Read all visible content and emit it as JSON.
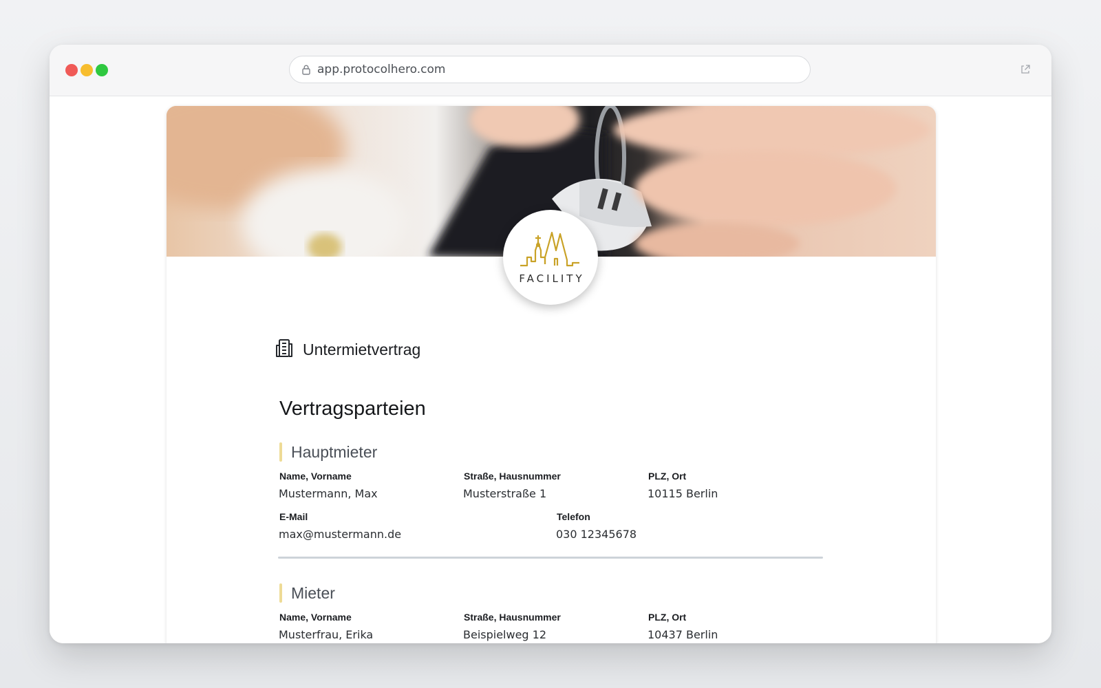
{
  "browser": {
    "url": "app.protocolhero.com"
  },
  "logo": {
    "text": "FACILITY"
  },
  "document": {
    "title": "Untermietvertrag",
    "section_title": "Vertragsparteien"
  },
  "hauptmieter": {
    "heading": "Hauptmieter",
    "labels": {
      "name": "Name, Vorname",
      "street": "Straße, Hausnummer",
      "city": "PLZ, Ort",
      "email": "E-Mail",
      "phone": "Telefon"
    },
    "values": {
      "name": "Mustermann, Max",
      "street": "Musterstraße 1",
      "city": "10115 Berlin",
      "email": "max@mustermann.de",
      "phone": "030 12345678"
    }
  },
  "mieter": {
    "heading": "Mieter",
    "labels": {
      "name": "Name, Vorname",
      "street": "Straße, Hausnummer",
      "city": "PLZ, Ort"
    },
    "values": {
      "name": "Musterfrau, Erika",
      "street": "Beispielweg 12",
      "city": "10437 Berlin"
    }
  },
  "colors": {
    "accent_bar": "#eedb96",
    "logo_gold": "#c9a227",
    "traffic_red": "#f05a57",
    "traffic_yellow": "#f7bd2e",
    "traffic_green": "#2fc840"
  },
  "icons": {
    "lock": "lock-icon",
    "external": "external-link-icon",
    "document": "building-document-icon"
  }
}
